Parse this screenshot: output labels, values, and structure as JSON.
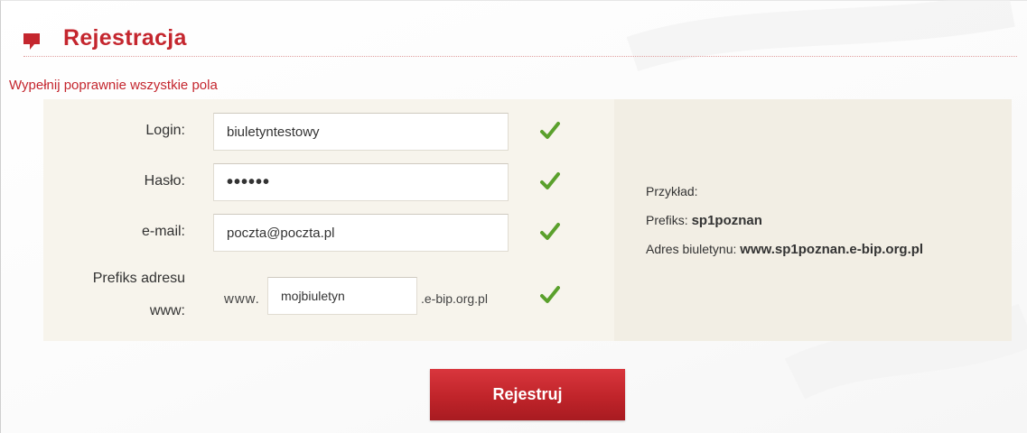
{
  "header": {
    "title": "Rejestracja"
  },
  "error_message": "Wypełnij poprawnie wszystkie pola",
  "form": {
    "login": {
      "label": "Login:",
      "value": "biuletyntestowy"
    },
    "password": {
      "label": "Hasło:",
      "value": "••••••"
    },
    "email": {
      "label": "e-mail:",
      "value": "poczta@poczta.pl"
    },
    "prefix": {
      "label_line1": "Prefiks adresu",
      "label_line2": "www:",
      "pre_text": "www.",
      "value": "mojbiuletyn",
      "post_text": ".e-bip.org.pl"
    }
  },
  "example": {
    "heading": "Przykład:",
    "prefix_label": "Prefiks:",
    "prefix_value": "sp1poznan",
    "address_label": "Adres biuletynu:",
    "address_value": "www.sp1poznan.e-bip.org.pl"
  },
  "submit_label": "Rejestruj",
  "colors": {
    "accent": "#c4262e",
    "check": "#5aa02c",
    "panel": "#f2eee4"
  },
  "icons": {
    "header": "flag-icon",
    "valid": "check-icon"
  }
}
